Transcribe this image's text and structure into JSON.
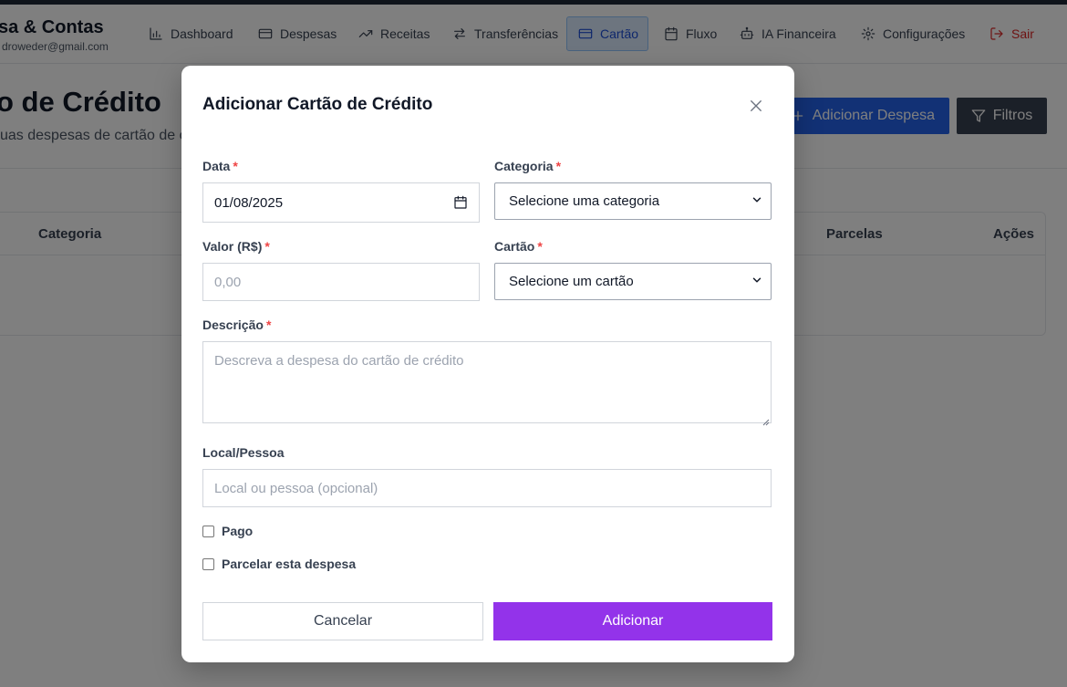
{
  "app": {
    "brand_title": "sa & Contas",
    "user_email": "droweder@gmail.com"
  },
  "nav": {
    "items": [
      {
        "label": "Dashboard",
        "icon": "bar-chart-icon"
      },
      {
        "label": "Despesas",
        "icon": "card-icon"
      },
      {
        "label": "Receitas",
        "icon": "trending-up-icon"
      },
      {
        "label": "Transferências",
        "icon": "transfer-icon"
      },
      {
        "label": "Cartão",
        "icon": "credit-card-icon",
        "active": true
      },
      {
        "label": "Fluxo",
        "icon": "calendar-icon"
      },
      {
        "label": "IA Financeira",
        "icon": "bot-icon"
      },
      {
        "label": "Configurações",
        "icon": "gear-icon"
      }
    ],
    "logout_label": "Sair"
  },
  "page": {
    "title": "o de Crédito",
    "subtitle": "uas despesas de cartão de cré",
    "add_expense_label": "Adicionar Despesa",
    "filters_label": "Filtros"
  },
  "table": {
    "headers": {
      "categoria": "Categoria",
      "parcelas": "Parcelas",
      "acoes": "Ações"
    }
  },
  "modal": {
    "title": "Adicionar Cartão de Crédito",
    "required_mark": "*",
    "date": {
      "label": "Data",
      "value": "01/08/2025"
    },
    "category": {
      "label": "Categoria",
      "selected": "Selecione uma categoria"
    },
    "amount": {
      "label": "Valor (R$)",
      "placeholder": "0,00"
    },
    "card": {
      "label": "Cartão",
      "selected": "Selecione um cartão"
    },
    "description": {
      "label": "Descrição",
      "placeholder": "Descreva a despesa do cartão de crédito"
    },
    "place": {
      "label": "Local/Pessoa",
      "placeholder": "Local ou pessoa (opcional)"
    },
    "paid": {
      "label": "Pago",
      "checked": false
    },
    "installments": {
      "label": "Parcelar esta despesa",
      "checked": false
    },
    "cancel_label": "Cancelar",
    "submit_label": "Adicionar"
  },
  "colors": {
    "primary_blue": "#2563eb",
    "dark_button": "#374151",
    "submit_purple": "#9333ea",
    "required_red": "#ef4444",
    "logout_red": "#dc2626",
    "overlay": "rgba(0,0,0,0.5)"
  }
}
